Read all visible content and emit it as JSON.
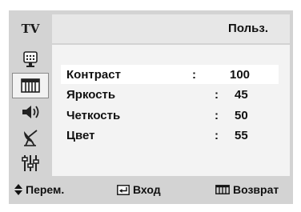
{
  "header": {
    "source_tab": "TV",
    "title": "Польз."
  },
  "sidebar": {
    "icons": [
      {
        "name": "picture-icon"
      },
      {
        "name": "film-icon",
        "active": true
      },
      {
        "name": "speaker-icon"
      },
      {
        "name": "antenna-icon"
      },
      {
        "name": "equalizer-icon"
      }
    ]
  },
  "menu": {
    "items": [
      {
        "label": "Контраст",
        "separator": ":",
        "value": "100",
        "selected": true
      },
      {
        "label": "Яркость",
        "separator": ":",
        "value": "45"
      },
      {
        "label": "Четкость",
        "separator": ":",
        "value": "50"
      },
      {
        "label": "Цвет",
        "separator": ":",
        "value": "55"
      }
    ]
  },
  "footer": {
    "move_icon": "up-down-arrows-icon",
    "move_label": "Перем.",
    "enter_icon": "enter-icon",
    "enter_label": "Вход",
    "return_icon": "menu-icon",
    "return_label": "Возврат"
  },
  "colors": {
    "frame": "#d3d3d3",
    "panel": "#f3f3f3",
    "selected_row": "#ffffff"
  }
}
